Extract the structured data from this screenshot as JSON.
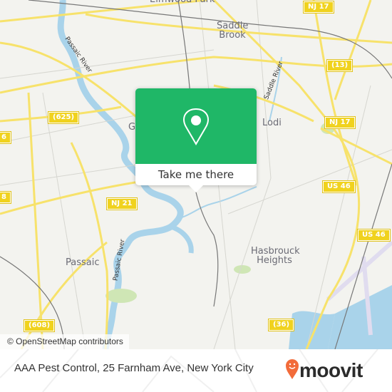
{
  "map": {
    "place_labels": [
      {
        "id": "elmwood-park",
        "text": "Elmwood Park"
      },
      {
        "id": "saddle-brook",
        "text": "Saddle Brook"
      },
      {
        "id": "lodi",
        "text": "Lodi"
      },
      {
        "id": "garfield",
        "text": "G"
      },
      {
        "id": "passaic",
        "text": "Passaic"
      },
      {
        "id": "hasbrouck-heights",
        "text": "Hasbrouck Heights"
      }
    ],
    "river_labels": [
      {
        "id": "passaic-river-north",
        "text": "Passaic River"
      },
      {
        "id": "passaic-river-south",
        "text": "Passaic River"
      },
      {
        "id": "saddle-river",
        "text": "Saddle River"
      }
    ],
    "route_shields": [
      {
        "id": "nj17-top",
        "text": "NJ 17"
      },
      {
        "id": "cr13",
        "text": "(13)"
      },
      {
        "id": "cr625",
        "text": "(625)"
      },
      {
        "id": "nj17-mid",
        "text": "NJ 17"
      },
      {
        "id": "left-6",
        "text": "6"
      },
      {
        "id": "us46-a",
        "text": "US 46"
      },
      {
        "id": "left-8",
        "text": "8"
      },
      {
        "id": "nj21",
        "text": "NJ 21"
      },
      {
        "id": "us46-b",
        "text": "US 46"
      },
      {
        "id": "cr608",
        "text": "(608)"
      },
      {
        "id": "cr36",
        "text": "(36)"
      }
    ],
    "attribution": "© OpenStreetMap contributors",
    "colors": {
      "land": "#f3f3ef",
      "road": "#f7e26b",
      "water": "#a9d3ea",
      "park": "#cfe6b5",
      "rail": "#777777",
      "airport": "#e0dcef"
    }
  },
  "popup": {
    "icon": "location-pin-icon",
    "cta_label": "Take me there",
    "accent_color": "#1fb767"
  },
  "footer": {
    "place_title": "AAA Pest Control, 25 Farnham Ave, New York City",
    "brand_name": "moovit",
    "brand_icon": "moovit-smiley-pin-icon",
    "brand_color": "#f26b3a"
  }
}
